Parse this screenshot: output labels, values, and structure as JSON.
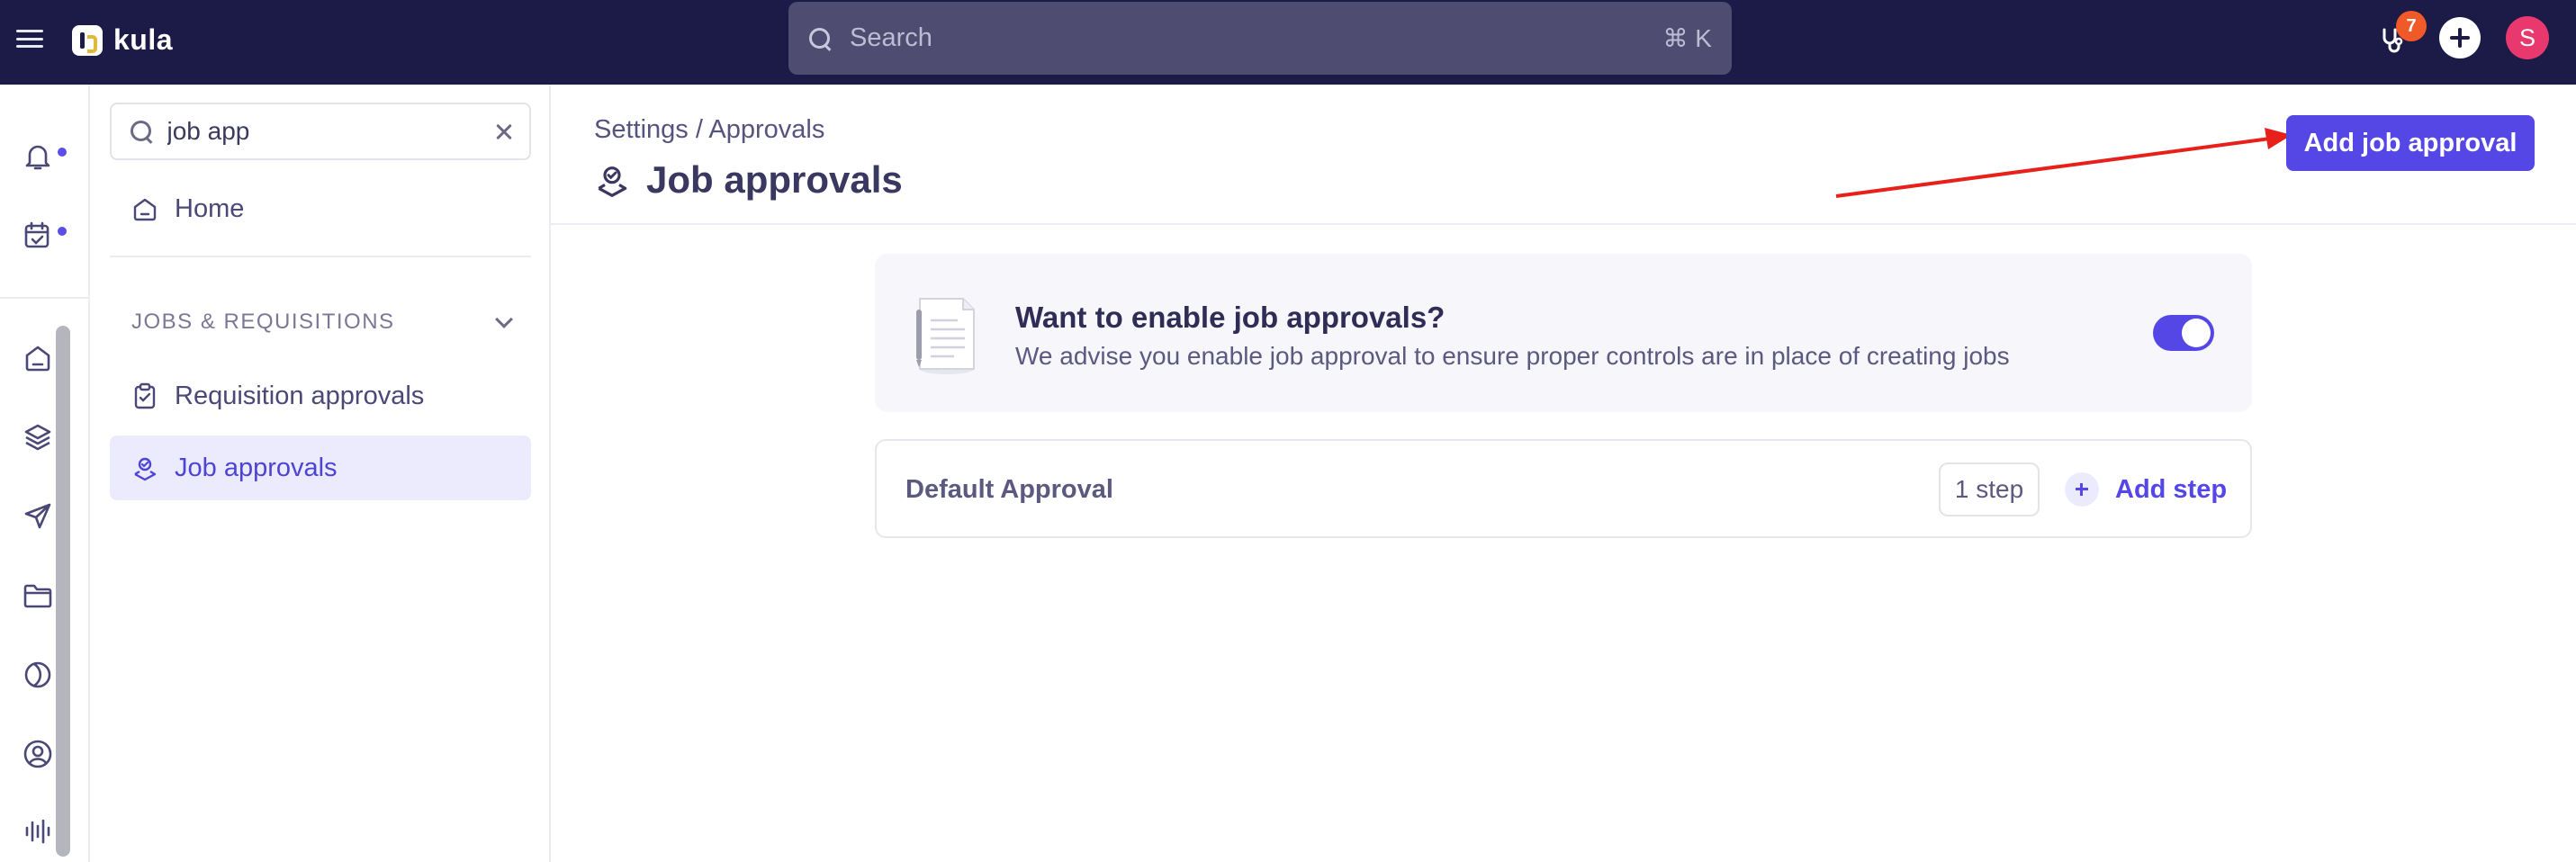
{
  "topbar": {
    "app_name": "kula",
    "search_placeholder": "Search",
    "search_shortcut": "⌘ K",
    "notification_count": "7",
    "avatar_initial": "S"
  },
  "sidebar": {
    "search_value": "job app",
    "home_label": "Home",
    "section_title": "JOBS & REQUISITIONS",
    "items": [
      {
        "label": "Requisition approvals",
        "icon": "clipboard-check-icon"
      },
      {
        "label": "Job approvals",
        "icon": "user-badge-icon",
        "active": true
      }
    ]
  },
  "rail": {
    "icons": [
      "bell-icon",
      "calendar-check-icon",
      "home-icon",
      "layers-icon",
      "send-icon",
      "folder-icon",
      "contrast-icon",
      "user-circle-icon",
      "audio-wave-icon"
    ]
  },
  "header": {
    "breadcrumb": "Settings / Approvals",
    "title": "Job approvals",
    "primary_button": "Add job approval"
  },
  "info_card": {
    "title": "Want to enable job approvals?",
    "description": "We advise you enable job approval to ensure proper controls are in place of creating jobs",
    "toggle_on": true
  },
  "approvals": [
    {
      "name": "Default Approval",
      "steps": "1 step",
      "add_label": "Add step"
    }
  ],
  "colors": {
    "topbar": "#1c1a46",
    "accent": "#5447e5",
    "badge": "#f05a28",
    "avatar": "#e8386e",
    "annotation_arrow": "#e8201c"
  }
}
